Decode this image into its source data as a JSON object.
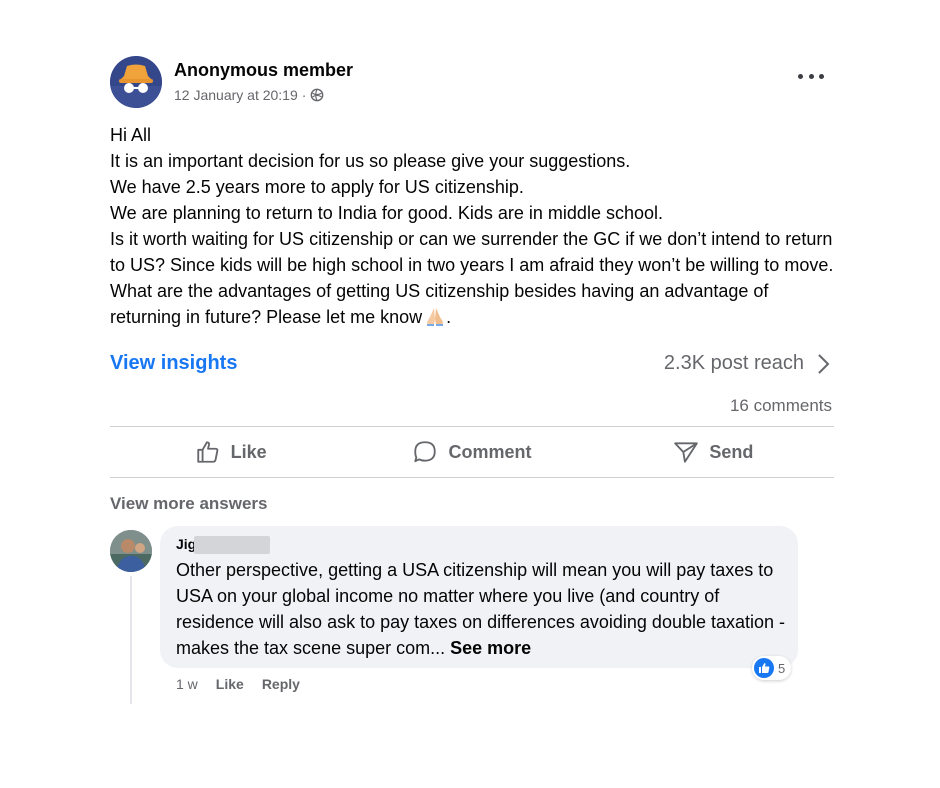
{
  "post": {
    "author": "Anonymous member",
    "timestamp": "12 January at 20:19",
    "separator": "·",
    "privacy_icon": "globe-icon",
    "more_icon": "more-horizontal-icon",
    "lines": [
      "Hi All",
      "It is an important decision for us so please give your suggestions.",
      "We have 2.5 years more to apply for US citizenship.",
      "We are planning to return to India for good. Kids are in middle school.",
      "Is it worth waiting for US citizenship or can we surrender the GC if we don’t intend to return to US? Since kids will be high school in two years I am afraid they won’t be willing to move.",
      "What are the advantages of getting US citizenship besides having an advantage of returning in future? Please let me know"
    ],
    "last_line_suffix": "."
  },
  "insights": {
    "link": "View insights",
    "reach": "2.3K post reach"
  },
  "comments_count": "16 comments",
  "actions": {
    "like": "Like",
    "comment": "Comment",
    "send": "Send"
  },
  "view_more": "View more answers",
  "comment": {
    "author_visible": "Jig",
    "text": "Other perspective, getting a USA citizenship will mean you will pay taxes to USA on your global income no matter where you live (and country of residence will also ask to pay taxes on differences avoiding double taxation - makes the tax scene super com...",
    "see_more": "See more",
    "age": "1 w",
    "like": "Like",
    "reply": "Reply",
    "reaction_count": "5"
  },
  "colors": {
    "link_blue": "#1877f2",
    "secondary_text": "#65676b",
    "bubble_bg": "#f0f2f5"
  }
}
